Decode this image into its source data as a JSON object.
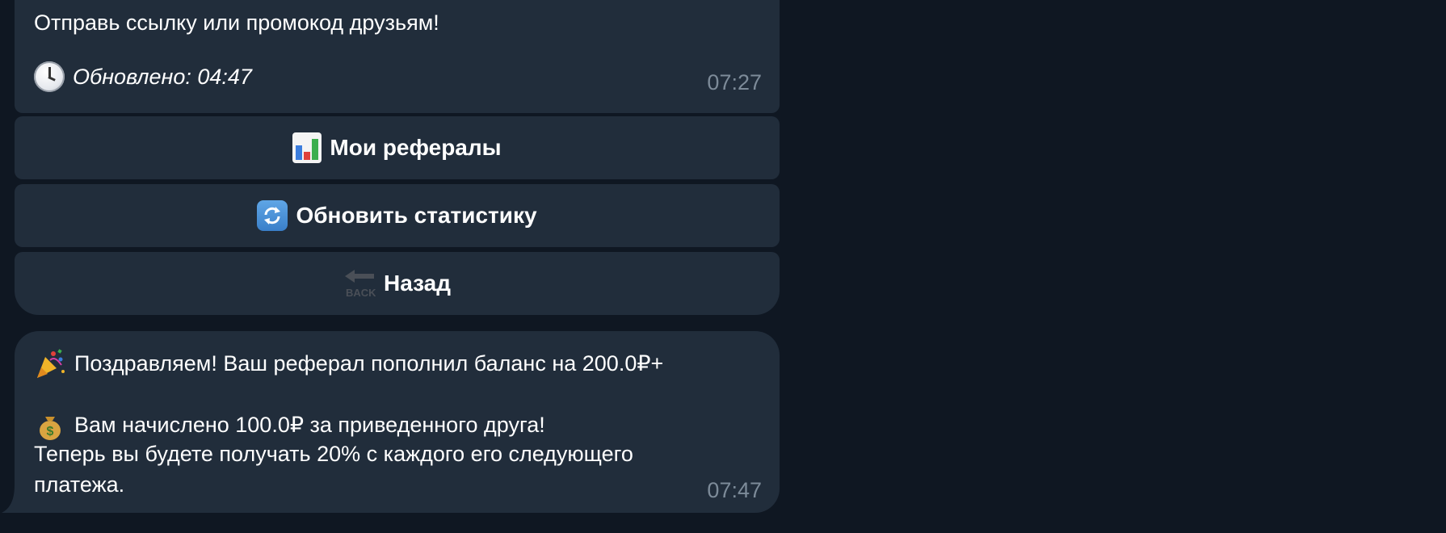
{
  "messages": {
    "top": {
      "line1": "Отправь ссылку или промокод друзьям!",
      "updated_text": "Обновлено: 04:47",
      "updated_icon": "clock-icon",
      "time": "07:27"
    },
    "bottom": {
      "line1": "Поздравляем! Ваш реферал пополнил баланс на 200.0₽+",
      "line1_icon": "party-popper-icon",
      "line2": "Вам начислено 100.0₽ за приведенного друга!",
      "line2_icon": "money-bag-icon",
      "line3": "Теперь вы будете получать 20% с каждого его следующего",
      "line4": "платежа.",
      "time": "07:47"
    }
  },
  "keyboard": {
    "referrals": {
      "label": "Мои рефералы",
      "icon": "bar-chart-icon"
    },
    "refresh": {
      "label": "Обновить статистику",
      "icon": "refresh-icon"
    },
    "back": {
      "label": "Назад",
      "icon": "back-arrow-icon",
      "icon_text": "BACK"
    }
  },
  "colors": {
    "background": "#0f1722",
    "bubble": "#212d3b",
    "timestamp": "#7d8b99",
    "text": "#ffffff"
  }
}
